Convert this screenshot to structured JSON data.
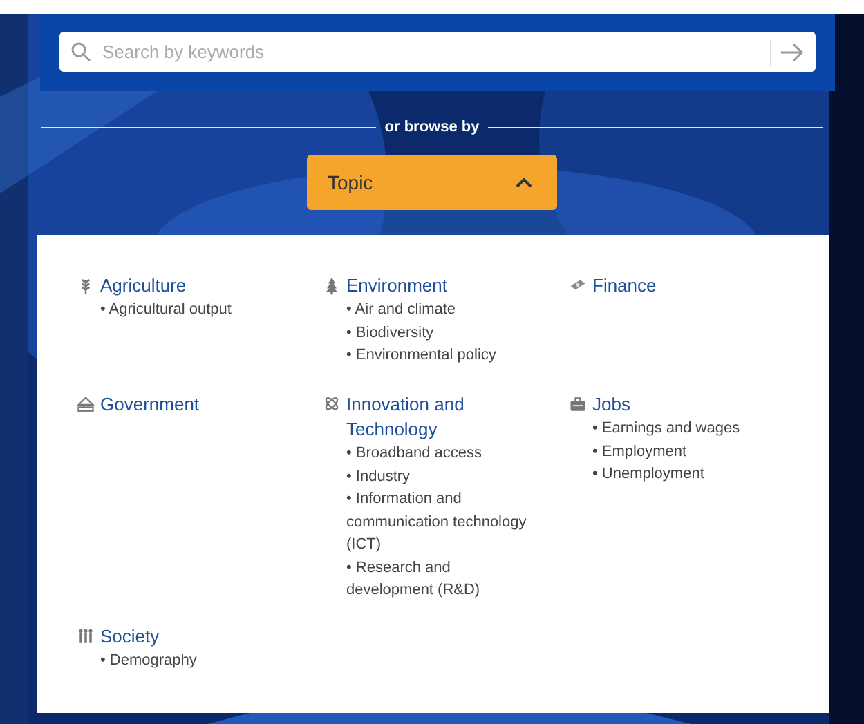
{
  "search": {
    "placeholder": "Search by keywords"
  },
  "divider": {
    "label": "or browse by"
  },
  "browse_button": {
    "label": "Topic",
    "expanded": true
  },
  "topics": [
    {
      "title": "Agriculture",
      "items": [
        "• Agricultural output"
      ]
    },
    {
      "title": "Environment",
      "items": [
        "• Air and climate",
        "• Biodiversity",
        "• Environmental policy"
      ]
    },
    {
      "title": "Finance"
    },
    {
      "title": "Government"
    },
    {
      "title": "Innovation and Technology",
      "items": [
        "• Broadband access",
        "• Industry",
        "• Information and communication technology (ICT)",
        "• Research and development (R&D)"
      ]
    },
    {
      "title": "Jobs",
      "items": [
        "• Earnings and wages",
        "• Employment",
        "• Unemployment"
      ]
    },
    {
      "title": "Society",
      "items": [
        "• Demography"
      ]
    }
  ]
}
